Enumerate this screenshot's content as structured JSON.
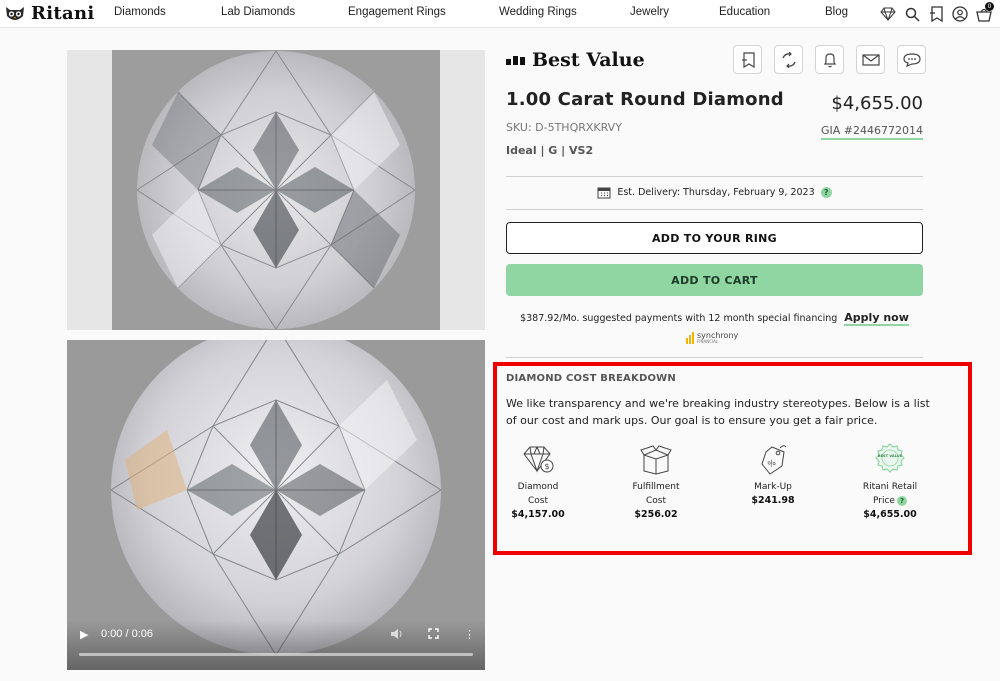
{
  "nav": {
    "brand": "Ritani",
    "links": [
      "Diamonds",
      "Lab Diamonds",
      "Engagement Rings",
      "Wedding Rings",
      "Jewelry",
      "Education",
      "Blog"
    ],
    "icons": [
      "diamond-icon",
      "search-icon",
      "wishlist-icon",
      "account-icon",
      "cart-icon"
    ],
    "cart_count": "0"
  },
  "video": {
    "time": "0:00 / 0:06",
    "progress": 0
  },
  "product": {
    "badge": "Best Value",
    "action_icons": [
      "bookmark-icon",
      "compare-icon",
      "bell-icon",
      "email-icon",
      "chat-icon"
    ],
    "title": "1.00 Carat Round Diamond",
    "price": "$4,655.00",
    "sku": "SKU: D-5THQRXKRVY",
    "gia": "GIA #2446772014",
    "specs": "Ideal | G | VS2",
    "delivery": "Est. Delivery: Thursday, February 9, 2023",
    "help": "?",
    "add_to_ring": "ADD TO YOUR RING",
    "add_to_cart": "ADD TO CART",
    "financing_text": "$387.92/Mo. suggested payments with 12 month special financing",
    "apply_now": "Apply now",
    "synchrony": "synchrony",
    "synchrony_sub": "FINANCIAL"
  },
  "breakdown": {
    "title": "DIAMOND COST BREAKDOWN",
    "description": "We like transparency and we're breaking industry stereotypes. Below is a list of our cost and mark ups. Our goal is to ensure you get a fair price.",
    "items": [
      {
        "label1": "Diamond",
        "label2": "Cost",
        "value": "$4,157.00",
        "icon": "diamond-cost-icon"
      },
      {
        "label1": "Fulfillment",
        "label2": "Cost",
        "value": "$256.02",
        "icon": "box-icon"
      },
      {
        "label1": "Mark-Up",
        "label2": "",
        "value": "$241.98",
        "icon": "price-tag-icon"
      },
      {
        "label1": "Ritani Retail",
        "label2": "Price",
        "value": "$4,655.00",
        "icon": "best-value-badge-icon"
      }
    ],
    "badge_text": "BEST VALUE"
  },
  "colors": {
    "accent_green": "#8fd6a2",
    "highlight_red": "#ee0000"
  }
}
